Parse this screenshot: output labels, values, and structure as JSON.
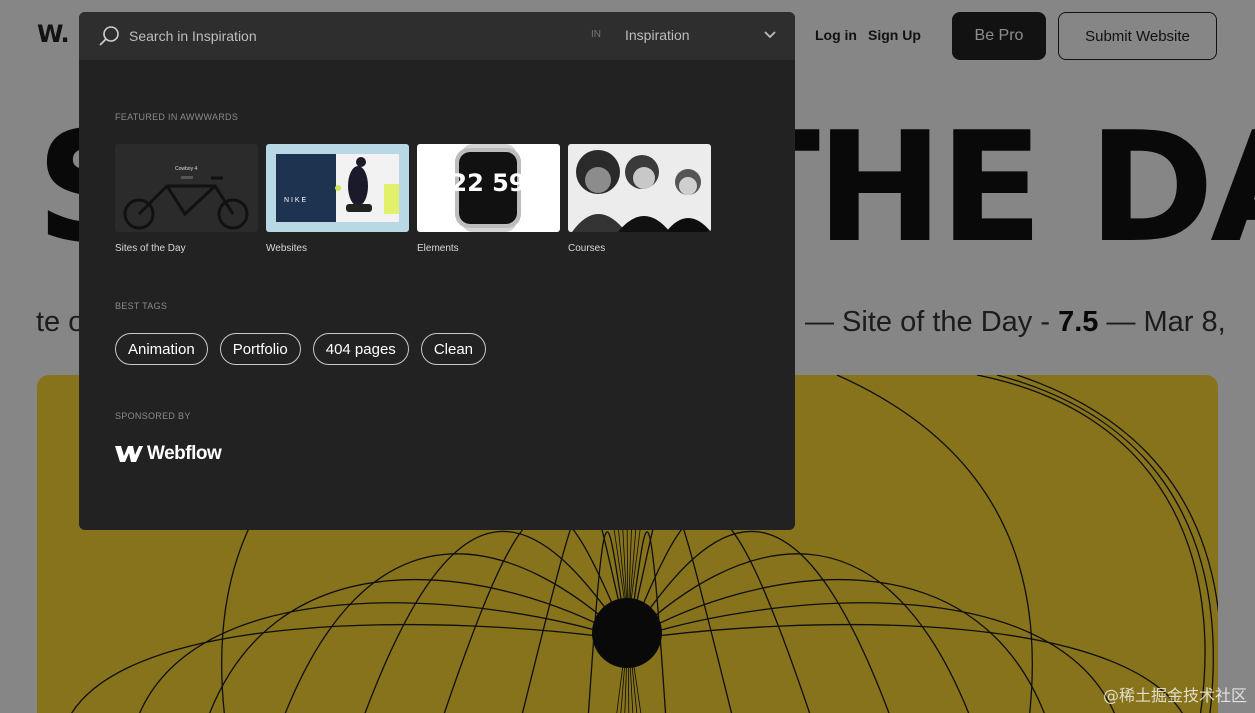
{
  "header": {
    "logo": "W.",
    "login_label": "Log in",
    "signup_label": "Sign Up",
    "be_pro_label": "Be Pro",
    "submit_label": "Submit Website"
  },
  "hero": {
    "title": "SITE OF THE DAY",
    "subtitle_left": "te o",
    "subtitle_sep1": "— Site of the Day -",
    "subtitle_score": "7.5",
    "subtitle_sep2": "— Mar 8,"
  },
  "search": {
    "placeholder": "Search in Inspiration",
    "value": "",
    "in_label": "IN",
    "category": "Inspiration",
    "icons": {
      "search": "search-icon",
      "chevron": "chevron-down-icon"
    }
  },
  "featured": {
    "label": "FEATURED IN AWWWARDS",
    "items": [
      {
        "label": "Sites of the Day",
        "thumb_text": "Cowboy 4"
      },
      {
        "label": "Websites",
        "thumb_text": "N I K E"
      },
      {
        "label": "Elements",
        "thumb_text": "22 59"
      },
      {
        "label": "Courses"
      }
    ]
  },
  "tags": {
    "label": "BEST TAGS",
    "items": [
      "Animation",
      "Portfolio",
      "404 pages",
      "Clean"
    ]
  },
  "sponsor": {
    "label": "SPONSORED BY",
    "name": "Webflow"
  },
  "watermark": "@稀土掘金技术社区",
  "colors": {
    "panel_bg": "#222222",
    "search_bar_bg": "#2e2e2e",
    "hero_card": "#f6d233",
    "button_dark": "#222222"
  }
}
